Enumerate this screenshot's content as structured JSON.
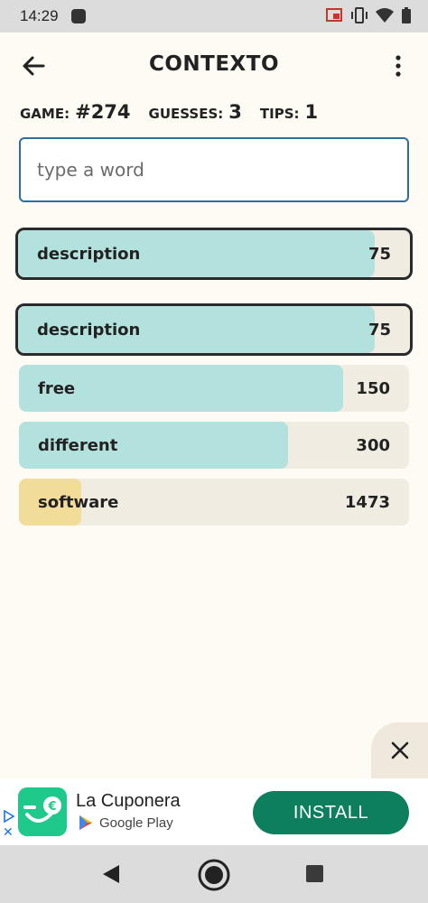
{
  "status_bar": {
    "time": "14:29"
  },
  "header": {
    "title": "CONTEXTO"
  },
  "stats": {
    "game_label": "GAME:",
    "game_value": "#274",
    "guesses_label": "GUESSES:",
    "guesses_value": "3",
    "tips_label": "TIPS:",
    "tips_value": "1"
  },
  "input": {
    "placeholder": "type a word",
    "value": ""
  },
  "last_guess": {
    "word": "description",
    "distance": "75",
    "fill_fraction": 0.91,
    "fill_color": "#b3e2de"
  },
  "guesses": [
    {
      "word": "description",
      "distance": "75",
      "fill_fraction": 0.91,
      "fill_color": "#b3e2de",
      "selected": true
    },
    {
      "word": "free",
      "distance": "150",
      "fill_fraction": 0.83,
      "fill_color": "#b3e2de",
      "selected": false
    },
    {
      "word": "different",
      "distance": "300",
      "fill_fraction": 0.69,
      "fill_color": "#b3e2de",
      "selected": false
    },
    {
      "word": "software",
      "distance": "1473",
      "fill_fraction": 0.16,
      "fill_color": "#f2dc9a",
      "selected": false
    }
  ],
  "ad": {
    "app_name": "La Cuponera",
    "store_label": "Google Play",
    "install_label": "INSTALL",
    "close_icon": "close-icon"
  },
  "colors": {
    "background": "#fdfbf4",
    "input_border": "#2f6f9f",
    "install_button": "#0d7f5f"
  }
}
